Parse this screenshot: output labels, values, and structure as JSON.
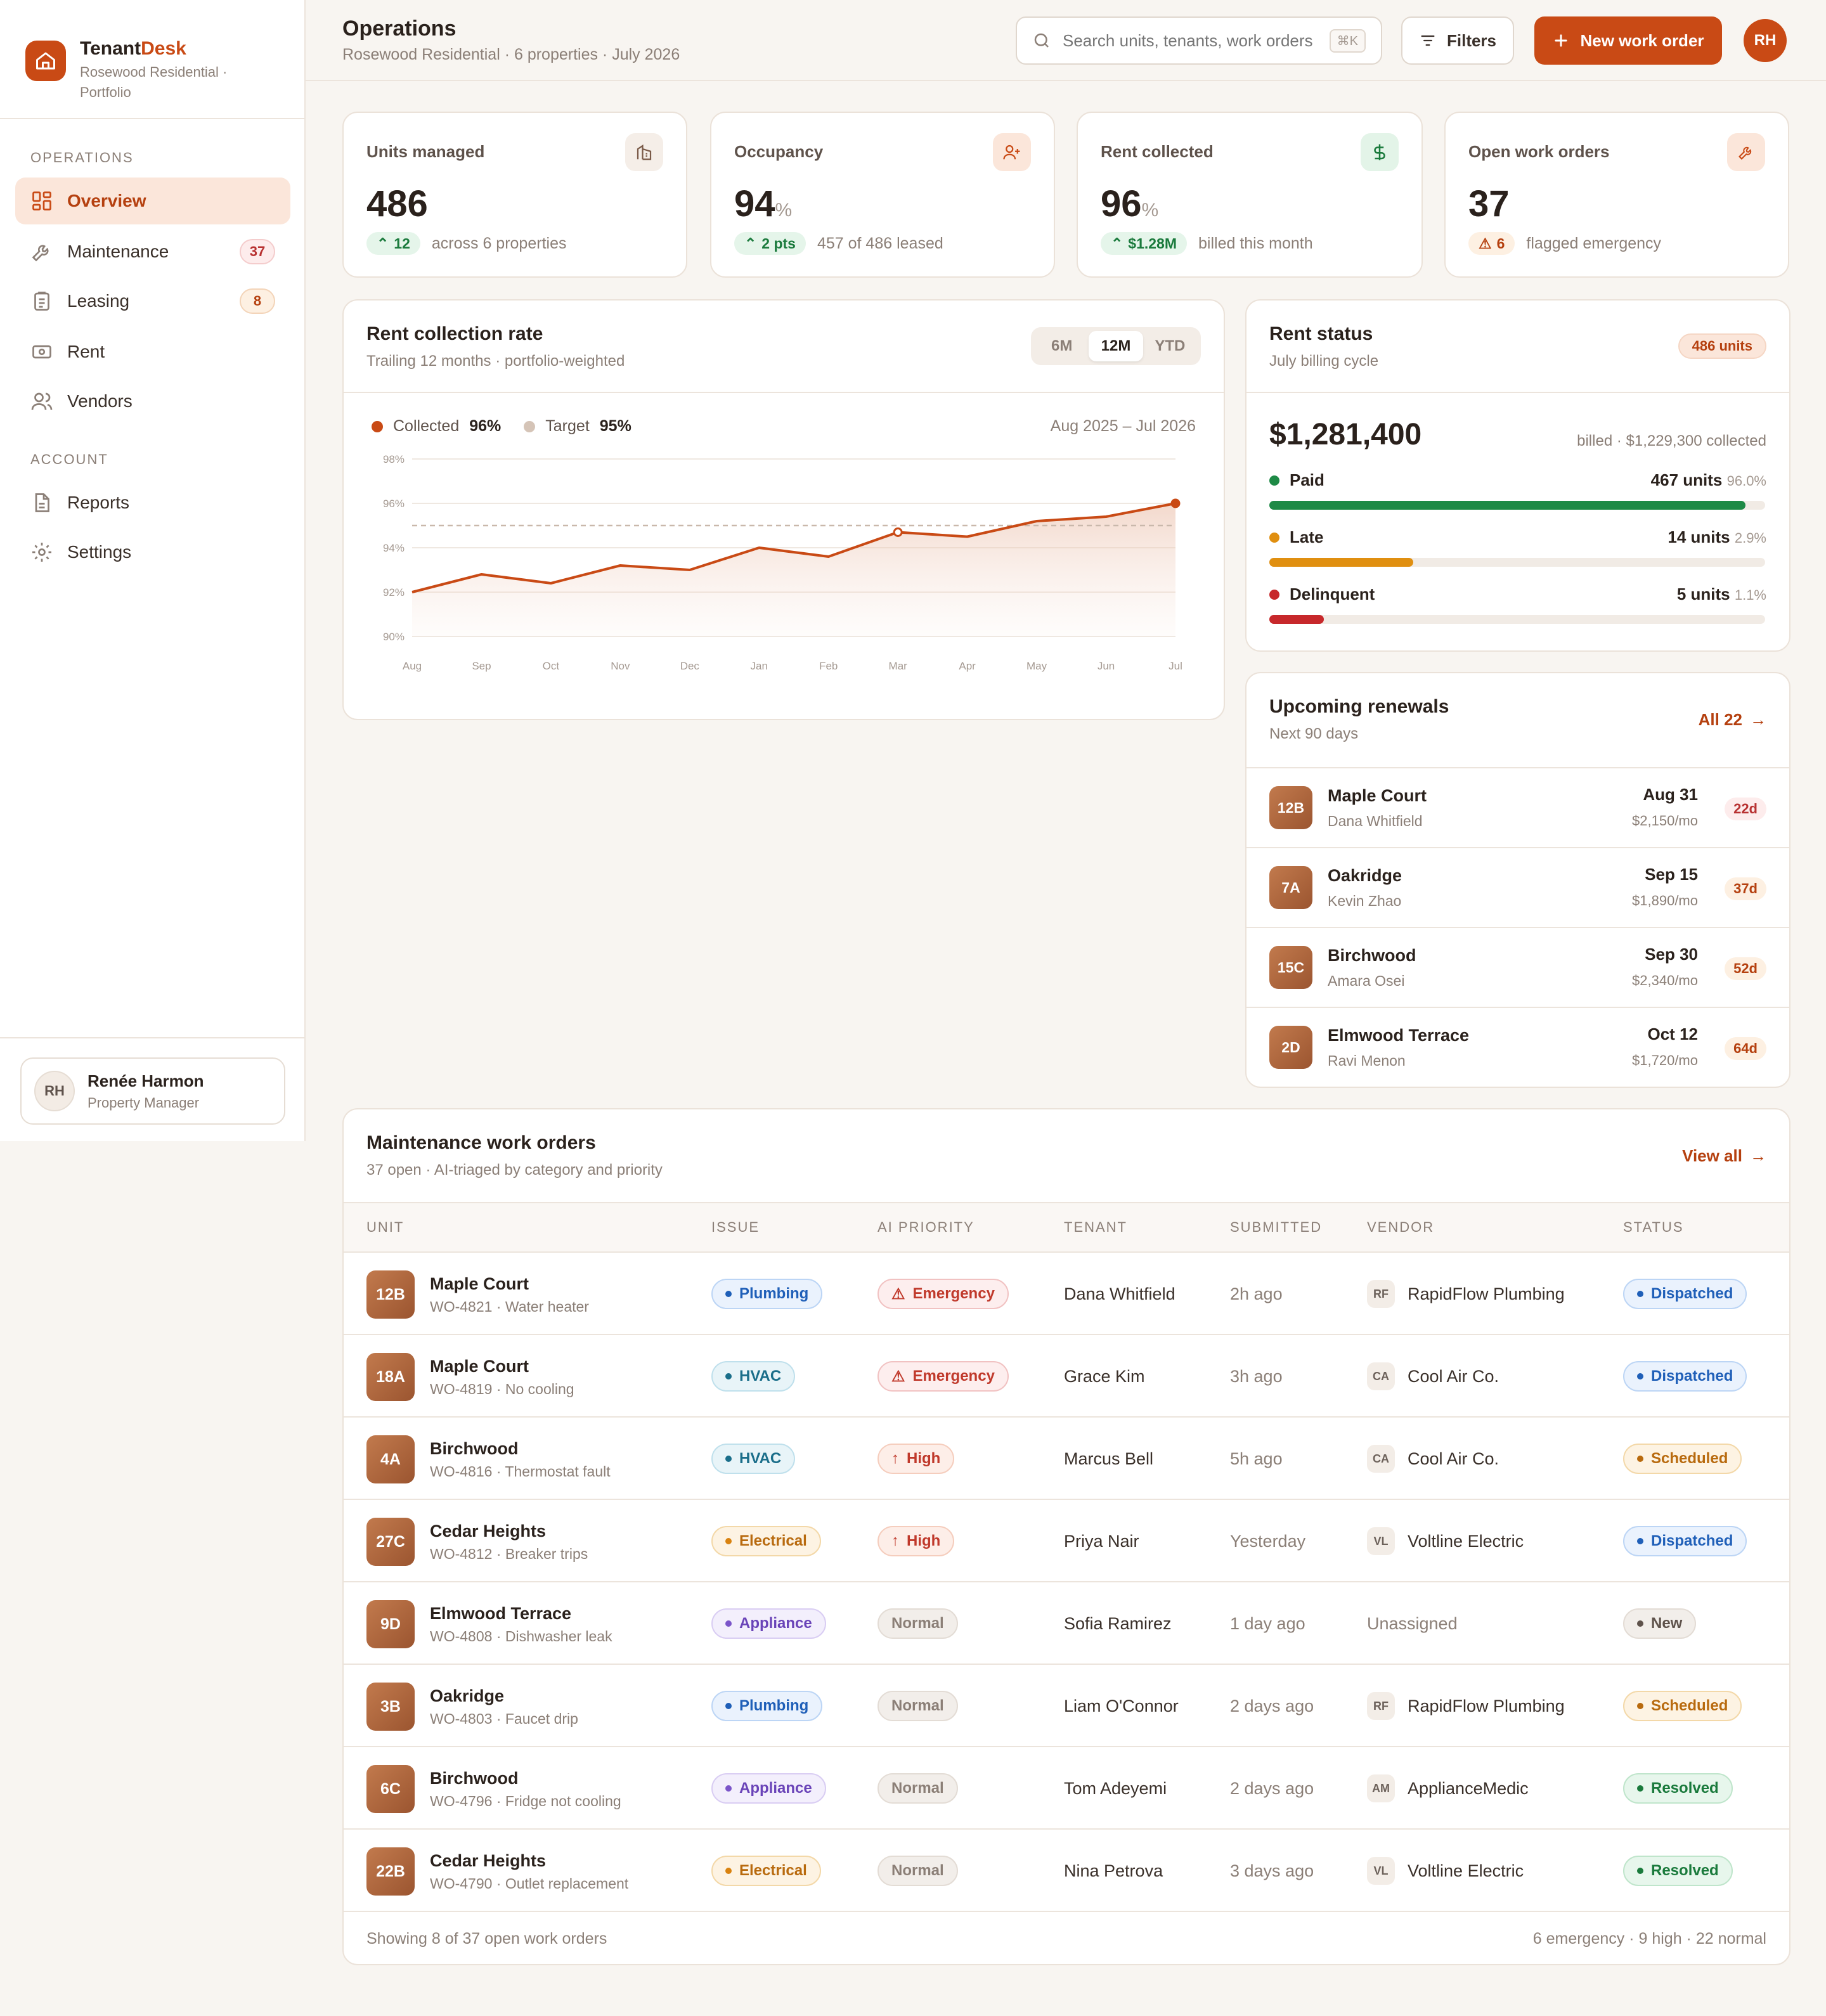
{
  "app": {
    "name_part1": "Tenant",
    "name_part2": "Desk",
    "subtitle": "Rosewood Residential · Portfolio"
  },
  "sidebar": {
    "sections": [
      "OPERATIONS",
      "ACCOUNT"
    ],
    "items": [
      {
        "label": "Overview",
        "icon": "grid-icon",
        "active": true
      },
      {
        "label": "Maintenance",
        "icon": "wrench-icon",
        "badge": "37"
      },
      {
        "label": "Leasing",
        "icon": "clipboard-icon",
        "badge": "8"
      },
      {
        "label": "Rent",
        "icon": "cash-icon"
      },
      {
        "label": "Vendors",
        "icon": "users-icon"
      },
      {
        "label": "Reports",
        "icon": "document-icon"
      },
      {
        "label": "Settings",
        "icon": "gear-icon"
      }
    ],
    "user": {
      "initials": "RH",
      "name": "Renée Harmon",
      "role": "Property Manager"
    }
  },
  "header": {
    "title": "Operations",
    "subtitle": "Rosewood Residential · 6 properties · July 2026",
    "search_placeholder": "Search units, tenants, work orders",
    "search_shortcut": "⌘K",
    "filters_label": "Filters",
    "new_label": "New work order",
    "avatar": "RH"
  },
  "kpis": [
    {
      "label": "Units managed",
      "value": "486",
      "unit": "",
      "delta": "12",
      "foot": "across 6 properties",
      "tone": "green",
      "icon": "building-icon"
    },
    {
      "label": "Occupancy",
      "value": "94",
      "unit": "%",
      "delta": "2 pts",
      "foot": "457 of 486 leased",
      "tone": "green",
      "icon": "user-plus-icon"
    },
    {
      "label": "Rent collected",
      "value": "96",
      "unit": "%",
      "delta": "$1.28M",
      "foot": "billed this month",
      "tone": "green",
      "icon": "dollar-icon"
    },
    {
      "label": "Open work orders",
      "value": "37",
      "unit": "",
      "delta": "6",
      "foot": "flagged emergency",
      "tone": "amber",
      "icon": "wrench-icon"
    }
  ],
  "collection": {
    "title": "Rent collection rate",
    "subtitle": "Trailing 12 months · portfolio-weighted",
    "ranges": [
      "6M",
      "12M",
      "YTD"
    ],
    "active_range": "12M",
    "legend_collected": "Collected",
    "legend_collected_value": "96%",
    "legend_target": "Target",
    "legend_target_value": "95%",
    "period": "Aug 2025 – Jul 2026"
  },
  "chart_data": {
    "type": "area",
    "x": [
      "Aug",
      "Sep",
      "Oct",
      "Nov",
      "Dec",
      "Jan",
      "Feb",
      "Mar",
      "Apr",
      "May",
      "Jun",
      "Jul"
    ],
    "series": [
      {
        "name": "Collected",
        "values": [
          92.0,
          92.8,
          92.4,
          93.2,
          93.0,
          94.0,
          93.6,
          94.7,
          94.5,
          95.2,
          95.4,
          96.0
        ],
        "color": "#c94a15"
      },
      {
        "name": "Target",
        "values": [
          95,
          95,
          95,
          95,
          95,
          95,
          95,
          95,
          95,
          95,
          95,
          95
        ],
        "color": "#c9b8ab"
      }
    ],
    "yticks": [
      "98%",
      "96%",
      "94%",
      "92%",
      "90%"
    ],
    "ylim": [
      90,
      98
    ],
    "grid": true
  },
  "rent_status": {
    "title": "Rent status",
    "subtitle": "July billing cycle",
    "badge": "486 units",
    "total": "$1,281,400",
    "total_note": "billed · $1,229,300 collected",
    "rows": [
      {
        "label": "Paid",
        "count": "467 units",
        "pct": "96.0%",
        "fraction": 0.96,
        "color": "#1e8a46"
      },
      {
        "label": "Late",
        "count": "14 units",
        "pct": "2.9%",
        "fraction": 0.29,
        "color": "#e08f10"
      },
      {
        "label": "Delinquent",
        "count": "5 units",
        "pct": "1.1%",
        "fraction": 0.11,
        "color": "#c7282b"
      }
    ]
  },
  "renewals": {
    "title": "Upcoming renewals",
    "subtitle": "Next 90 days",
    "link": "All 22",
    "items": [
      {
        "unit": "12B",
        "property": "Maple Court",
        "tenant": "Dana Whitfield",
        "date": "Aug 31",
        "rent": "$2,150/mo",
        "days": "22d",
        "tone": "red"
      },
      {
        "unit": "7A",
        "property": "Oakridge",
        "tenant": "Kevin Zhao",
        "date": "Sep 15",
        "rent": "$1,890/mo",
        "days": "37d",
        "tone": "amber"
      },
      {
        "unit": "15C",
        "property": "Birchwood",
        "tenant": "Amara Osei",
        "date": "Sep 30",
        "rent": "$2,340/mo",
        "days": "52d",
        "tone": "amber"
      },
      {
        "unit": "2D",
        "property": "Elmwood Terrace",
        "tenant": "Ravi Menon",
        "date": "Oct 12",
        "rent": "$1,720/mo",
        "days": "64d",
        "tone": "amber"
      }
    ]
  },
  "work_orders": {
    "title": "Maintenance work orders",
    "subtitle": "37 open · AI-triaged by category and priority",
    "link": "View all",
    "columns": [
      "UNIT",
      "ISSUE",
      "AI PRIORITY",
      "TENANT",
      "SUBMITTED",
      "VENDOR",
      "STATUS"
    ],
    "rows": [
      {
        "unit": "12B",
        "property": "Maple Court",
        "detail": "WO-4821 · Water heater",
        "category": "Plumbing",
        "priority": "Emergency",
        "tenant": "Dana Whitfield",
        "submitted": "2h ago",
        "vendor_init": "RF",
        "vendor": "RapidFlow Plumbing",
        "status": "Dispatched"
      },
      {
        "unit": "18A",
        "property": "Maple Court",
        "detail": "WO-4819 · No cooling",
        "category": "HVAC",
        "priority": "Emergency",
        "tenant": "Grace Kim",
        "submitted": "3h ago",
        "vendor_init": "CA",
        "vendor": "Cool Air Co.",
        "status": "Dispatched"
      },
      {
        "unit": "4A",
        "property": "Birchwood",
        "detail": "WO-4816 · Thermostat fault",
        "category": "HVAC",
        "priority": "High",
        "tenant": "Marcus Bell",
        "submitted": "5h ago",
        "vendor_init": "CA",
        "vendor": "Cool Air Co.",
        "status": "Scheduled"
      },
      {
        "unit": "27C",
        "property": "Cedar Heights",
        "detail": "WO-4812 · Breaker trips",
        "category": "Electrical",
        "priority": "High",
        "tenant": "Priya Nair",
        "submitted": "Yesterday",
        "vendor_init": "VL",
        "vendor": "Voltline Electric",
        "status": "Dispatched"
      },
      {
        "unit": "9D",
        "property": "Elmwood Terrace",
        "detail": "WO-4808 · Dishwasher leak",
        "category": "Appliance",
        "priority": "Normal",
        "tenant": "Sofia Ramirez",
        "submitted": "1 day ago",
        "vendor_init": "",
        "vendor": "Unassigned",
        "status": "New"
      },
      {
        "unit": "3B",
        "property": "Oakridge",
        "detail": "WO-4803 · Faucet drip",
        "category": "Plumbing",
        "priority": "Normal",
        "tenant": "Liam O'Connor",
        "submitted": "2 days ago",
        "vendor_init": "RF",
        "vendor": "RapidFlow Plumbing",
        "status": "Scheduled"
      },
      {
        "unit": "6C",
        "property": "Birchwood",
        "detail": "WO-4796 · Fridge not cooling",
        "category": "Appliance",
        "priority": "Normal",
        "tenant": "Tom Adeyemi",
        "submitted": "2 days ago",
        "vendor_init": "AM",
        "vendor": "ApplianceMedic",
        "status": "Resolved"
      },
      {
        "unit": "22B",
        "property": "Cedar Heights",
        "detail": "WO-4790 · Outlet replacement",
        "category": "Electrical",
        "priority": "Normal",
        "tenant": "Nina Petrova",
        "submitted": "3 days ago",
        "vendor_init": "VL",
        "vendor": "Voltline Electric",
        "status": "Resolved"
      }
    ],
    "footer_left": "Showing 8 of 37 open work orders",
    "footer_right": "6 emergency · 9 high · 22 normal"
  }
}
